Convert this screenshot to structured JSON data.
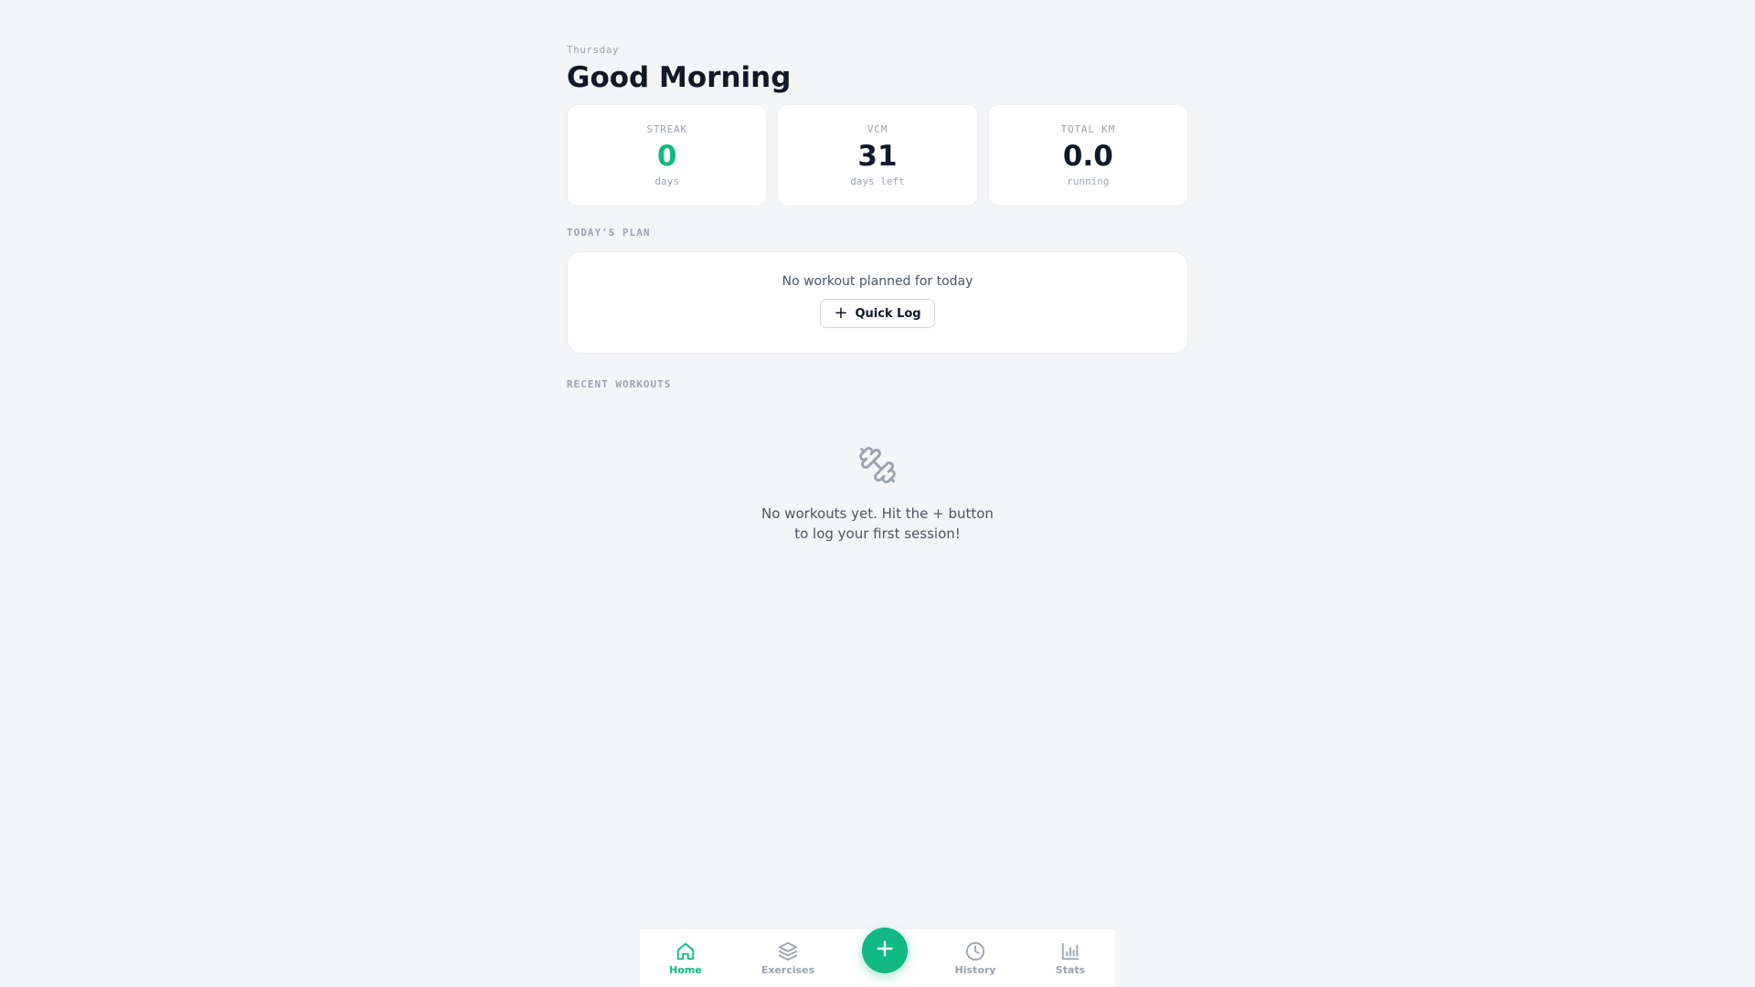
{
  "header": {
    "weekday": "Thursday",
    "greeting": "Good Morning"
  },
  "stats": [
    {
      "label": "STREAK",
      "value": "0",
      "unit": "days"
    },
    {
      "label": "VCM",
      "value": "31",
      "unit": "days left"
    },
    {
      "label": "TOTAL KM",
      "value": "0.0",
      "unit": "running"
    }
  ],
  "plan": {
    "title": "TODAY'S PLAN",
    "empty_text": "No workout planned for today",
    "quick_log_label": "Quick Log",
    "quick_log_icon": "plus-icon"
  },
  "recent": {
    "title": "RECENT WORKOUTS",
    "empty_icon": "dumbbell-icon",
    "empty_text": "No workouts yet. Hit the + button to log your first session!"
  },
  "nav": {
    "items": [
      {
        "label": "Home",
        "icon": "home-icon",
        "active": true
      },
      {
        "label": "Exercises",
        "icon": "layers-icon",
        "active": false
      },
      {
        "label": "History",
        "icon": "clock-icon",
        "active": false
      },
      {
        "label": "Stats",
        "icon": "bar-chart-icon",
        "active": false
      }
    ],
    "fab_icon": "plus-icon"
  },
  "colors": {
    "accent": "#10b981",
    "background": "#f4f5f7",
    "text_primary": "#111827",
    "text_muted": "#9ca3af"
  }
}
